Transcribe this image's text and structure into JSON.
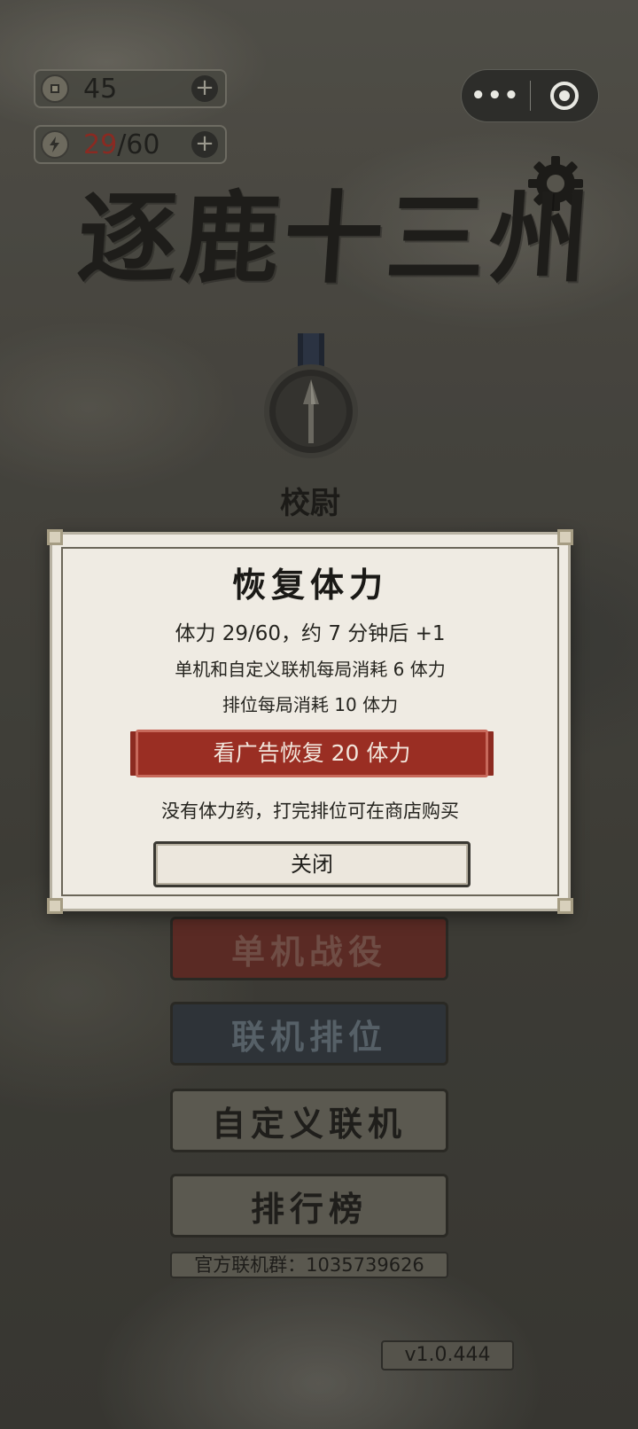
{
  "game_title": "逐鹿十三州",
  "resources": {
    "coins": "45",
    "energy_current": "29",
    "energy_separator": "/",
    "energy_max": "60"
  },
  "icons": {
    "coin": "coin-icon",
    "energy": "lightning-icon",
    "add": "plus-icon",
    "menu": "more-dots-icon",
    "exit": "target-icon",
    "settings": "gear-icon",
    "rank": "spearhead-medal-icon"
  },
  "rank_name": "校尉",
  "modal": {
    "title": "恢复体力",
    "line1": "体力 29/60，约 7 分钟后 +1",
    "line2": "单机和自定义联机每局消耗 6 体力",
    "line3": "排位每局消耗 10 体力",
    "ad_button": "看广告恢复 20 体力",
    "note": "没有体力药，打完排位可在商店购买",
    "close_button": "关闭"
  },
  "menu": {
    "campaign": "单机战役",
    "ranked": "联机排位",
    "custom": "自定义联机",
    "leaderboard": "排行榜"
  },
  "group_text": "官方联机群：1035739626",
  "version": "v1.0.444",
  "colors": {
    "accent_red": "#9a2e23",
    "energy_red": "#8a2a22",
    "paper": "#efebe3"
  }
}
